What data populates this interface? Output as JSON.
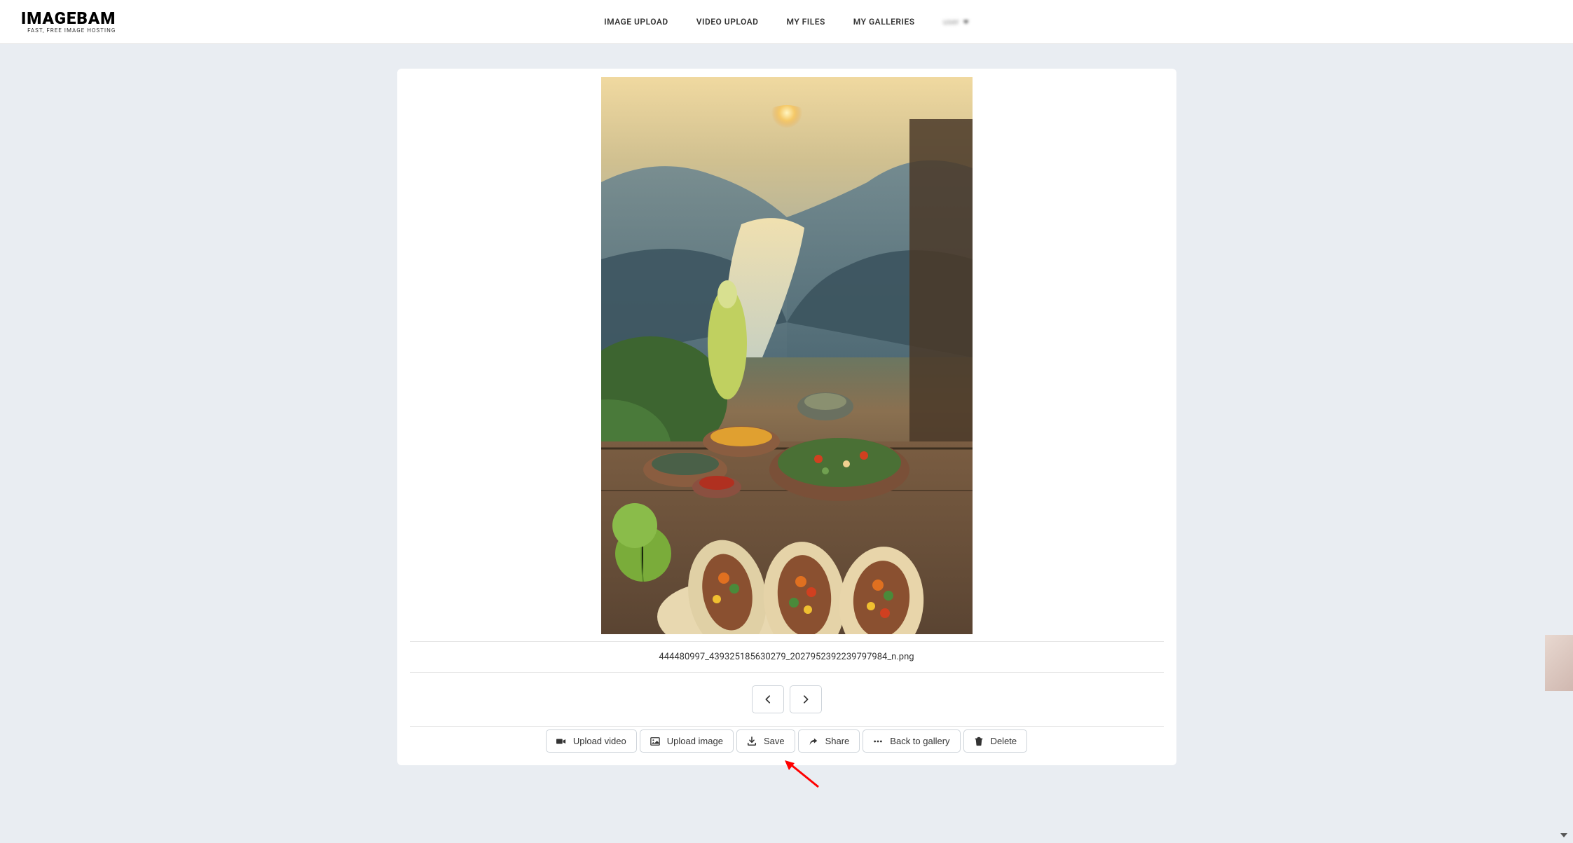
{
  "header": {
    "logo_main": "IMAGEBAM",
    "logo_sub": "FAST, FREE IMAGE HOSTING",
    "nav": {
      "image_upload": "IMAGE UPLOAD",
      "video_upload": "VIDEO UPLOAD",
      "my_files": "MY FILES",
      "my_galleries": "MY GALLERIES"
    },
    "user_label": "user"
  },
  "main": {
    "filename": "444480997_439325185630279_2027952392239797984_n.png",
    "actions": {
      "upload_video": "Upload video",
      "upload_image": "Upload image",
      "save": "Save",
      "share": "Share",
      "back_to_gallery": "Back to gallery",
      "delete": "Delete"
    }
  }
}
